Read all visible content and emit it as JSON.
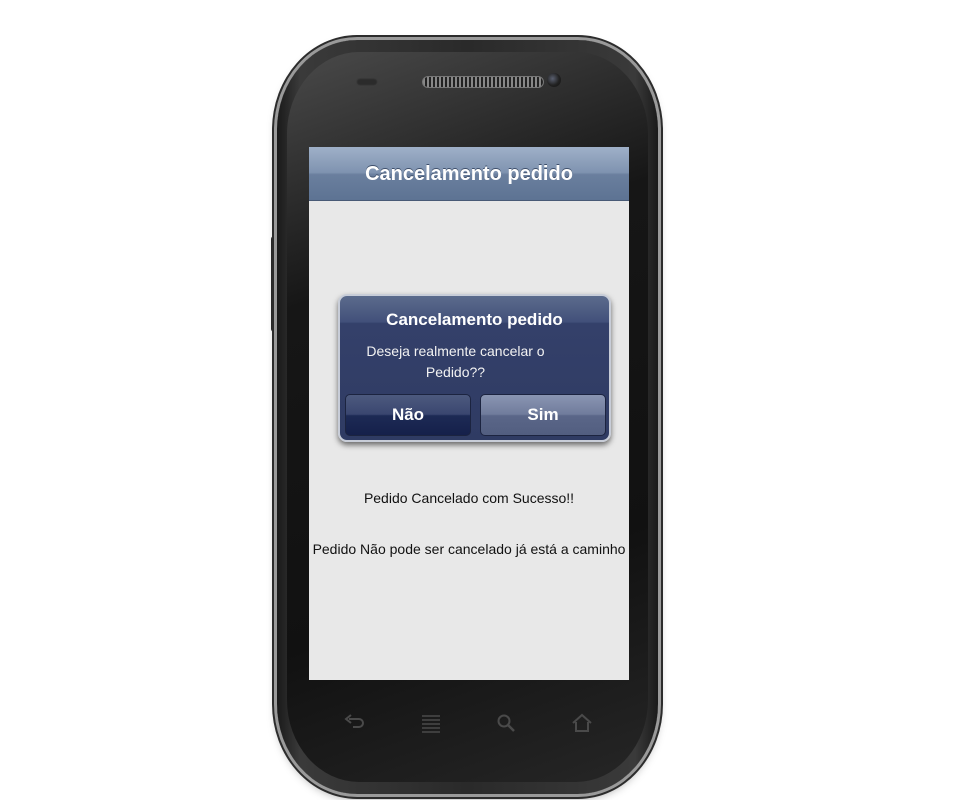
{
  "screen": {
    "header_title": "Cancelamento pedido",
    "success_message": "Pedido Cancelado com Sucesso!!",
    "failure_message": "Pedido Não pode ser cancelado já está a caminho"
  },
  "dialog": {
    "title": "Cancelamento pedido",
    "message": "Deseja realmente cancelar o Pedido??",
    "no_label": "Não",
    "yes_label": "Sim"
  },
  "nav_keys": [
    "back-icon",
    "menu-icon",
    "search-icon",
    "home-icon"
  ]
}
